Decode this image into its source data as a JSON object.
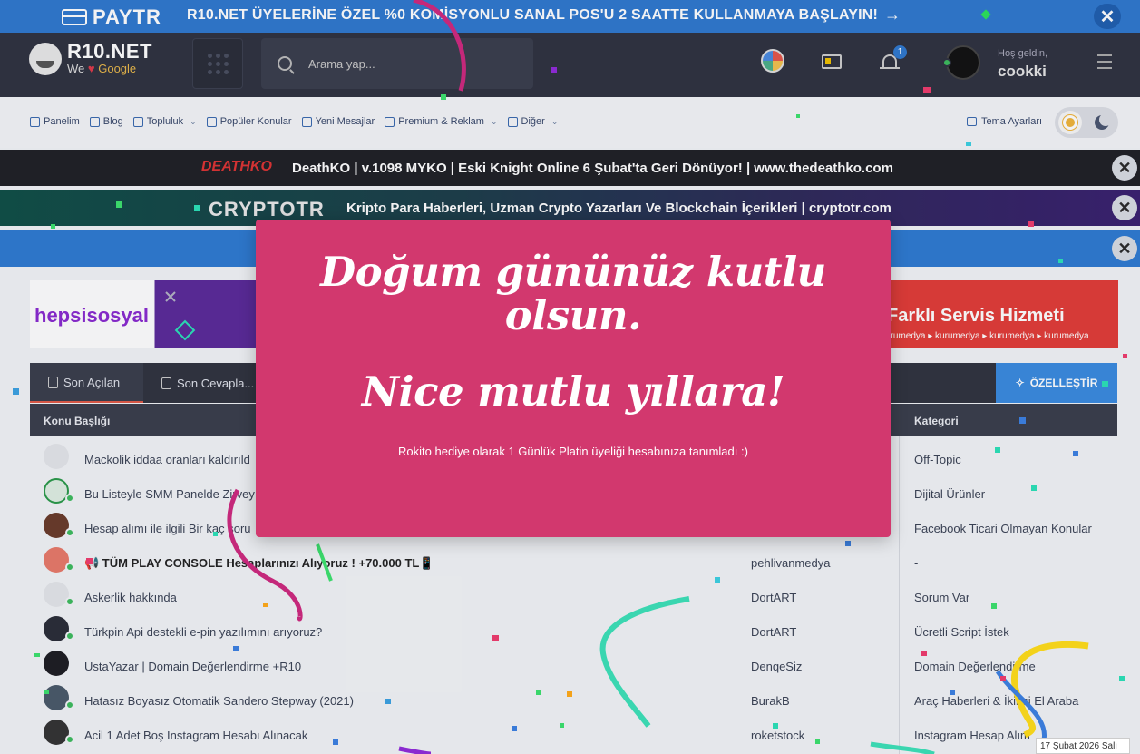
{
  "promo": {
    "brand": "PAYTR",
    "text": "R10.NET ÜYELERİNE ÖZEL %0 KOMİSYONLU SANAL POS'U 2 SAATTE KULLANMAYA BAŞLAYIN!",
    "arrow": "→",
    "close": "✕"
  },
  "header": {
    "brand_name": "R10.NET",
    "brand_sub_we": "We",
    "brand_sub_heart": "♥",
    "brand_sub_google": "Google",
    "search_placeholder": "Arama yap...",
    "notification_count": "1",
    "greeting": "Hoş geldin,",
    "username": "cookki"
  },
  "nav": {
    "items": [
      {
        "label": "Panelim",
        "caret": ""
      },
      {
        "label": "Blog",
        "caret": ""
      },
      {
        "label": "Topluluk",
        "caret": "⌄"
      },
      {
        "label": "Popüler Konular",
        "caret": ""
      },
      {
        "label": "Yeni Mesajlar",
        "caret": ""
      },
      {
        "label": "Premium & Reklam",
        "caret": "⌄"
      },
      {
        "label": "Diğer",
        "caret": "⌄"
      }
    ],
    "theme_label": "Tema Ayarları"
  },
  "bands": {
    "band1_logo": "DEATHKO",
    "band1_text": "DeathKO | v.1098 MYKO | Eski Knight Online 6 Şubat'ta Geri Dönüyor! | www.thedeathko.com",
    "band2_logo": "CRYPTOTR",
    "band2_text": "Kripto Para Haberleri, Uzman Crypto Yazarları Ve Blockchain İçerikleri | cryptotr.com",
    "close": "✕"
  },
  "ads": {
    "left_brand": "hepsisosyal",
    "right_title": "Farklı Servis Hizmeti",
    "right_sub": "urumedya ▸ kurumedya ▸ kurumedya ▸ kurumedya"
  },
  "tabs": {
    "items": [
      "Son Açılan",
      "Son Cevapla..."
    ],
    "customize": "ÖZELLEŞTİR"
  },
  "table": {
    "headers": {
      "title": "Konu Başlığı",
      "category": "Kategori"
    },
    "rows": [
      {
        "title": "Mackolik iddaa oranları kaldırıld",
        "author": "",
        "category": "Off-Topic",
        "bold": false
      },
      {
        "title": "Bu Listeyle SMM Panelde Zirvey",
        "author": "",
        "category": "Dijital Ürünler",
        "bold": false
      },
      {
        "title": "Hesap alımı ile ilgili Bir kaç soru",
        "author": "",
        "category": "Facebook Ticari Olmayan Konular",
        "bold": false
      },
      {
        "title": "📢 TÜM PLAY CONSOLE Hesaplarınızı Alıyoruz ! +70.000 TL📱",
        "author": "pehlivanmedya",
        "category": "-",
        "bold": true
      },
      {
        "title": "Askerlik hakkında",
        "author": "DortART",
        "category": "Sorum Var",
        "bold": false
      },
      {
        "title": "Türkpin Api destekli e-pin yazılımını arıyoruz?",
        "author": "DortART",
        "category": "Ücretli Script İstek",
        "bold": false
      },
      {
        "title": "UstaYazar | Domain Değerlendirme +R10",
        "author": "DenqeSiz",
        "category": "Domain Değerlendirme",
        "bold": false
      },
      {
        "title": "Hatasız Boyasız Otomatik Sandero Stepway (2021)",
        "author": "BurakB",
        "category": "Araç Haberleri & İkinci El Araba",
        "bold": false
      },
      {
        "title": "Acil 1 Adet Boş Instagram Hesabı Alınacak",
        "author": "roketstock",
        "category": "Instagram Hesap Alım",
        "bold": false
      }
    ]
  },
  "modal": {
    "line1": "Doğum gününüz kutlu olsun.",
    "line2": "Nice mutlu yıllara!",
    "message": "Rokito hediye olarak 1 Günlük Platin üyeliği hesabınıza tanımladı :)",
    "color": "#d2386e"
  },
  "date_tooltip": "17 Şubat 2026 Salı"
}
